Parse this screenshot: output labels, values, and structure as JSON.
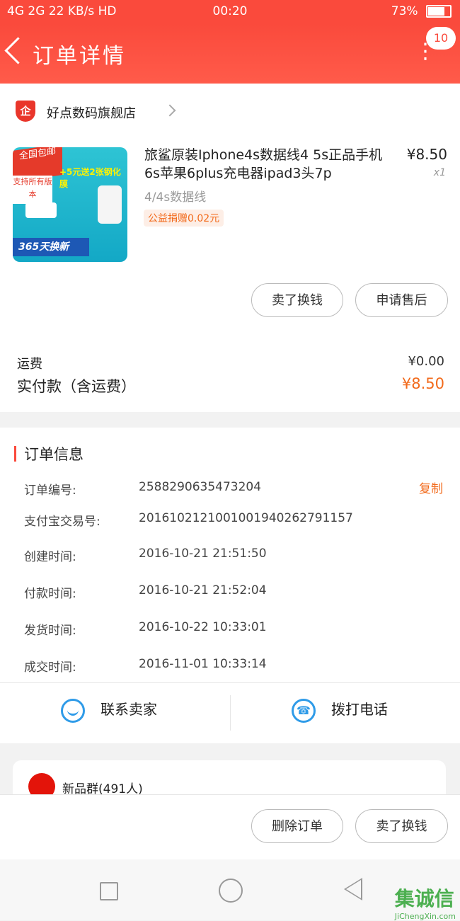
{
  "status": {
    "signal_text": "4G 2G",
    "speed": "22 KB/s",
    "hd": "HD",
    "time": "00:20",
    "battery": "73%",
    "battery_level": 0.73
  },
  "nav": {
    "title": "订单详情",
    "badge": "10"
  },
  "shop": {
    "name": "好点数码旗舰店",
    "icon_text": "企"
  },
  "product": {
    "title": "旅鲨原装Iphone4s数据线4 5s正品手机6s苹果6plus充电器ipad3头7p",
    "price": "¥8.50",
    "qty": "x1",
    "variant": "4/4s数据线",
    "donation": "公益捐赠0.02元",
    "thumb": {
      "badge1": "全国包邮",
      "badge2": "支持所有版本",
      "promo": "+5元送2张钢化膜",
      "strip": "365天换新"
    }
  },
  "buttons": {
    "sell": "卖了换钱",
    "after_sale": "申请售后",
    "delete": "删除订单",
    "sell2": "卖了换钱"
  },
  "fees": {
    "shipping_label": "运费",
    "shipping_value": "¥0.00",
    "paid_label": "实付款（含运费）",
    "paid_value": "¥8.50"
  },
  "order_info": {
    "title": "订单信息",
    "copy": "复制",
    "rows": [
      {
        "label": "订单编号:",
        "value": "2588290635473204"
      },
      {
        "label": "支付宝交易号:",
        "value": "2016102121001001940262791157"
      },
      {
        "label": "创建时间:",
        "value": "2016-10-21 21:51:50"
      },
      {
        "label": "付款时间:",
        "value": "2016-10-21 21:52:04"
      },
      {
        "label": "发货时间:",
        "value": "2016-10-22 10:33:01"
      },
      {
        "label": "成交时间:",
        "value": "2016-11-01 10:33:14"
      }
    ]
  },
  "contact": {
    "seller": "联系卖家",
    "call": "拨打电话"
  },
  "group": {
    "name": "新品群(491人)"
  },
  "watermark": {
    "main": "集诚信",
    "sub": "JiChengXin.com"
  }
}
